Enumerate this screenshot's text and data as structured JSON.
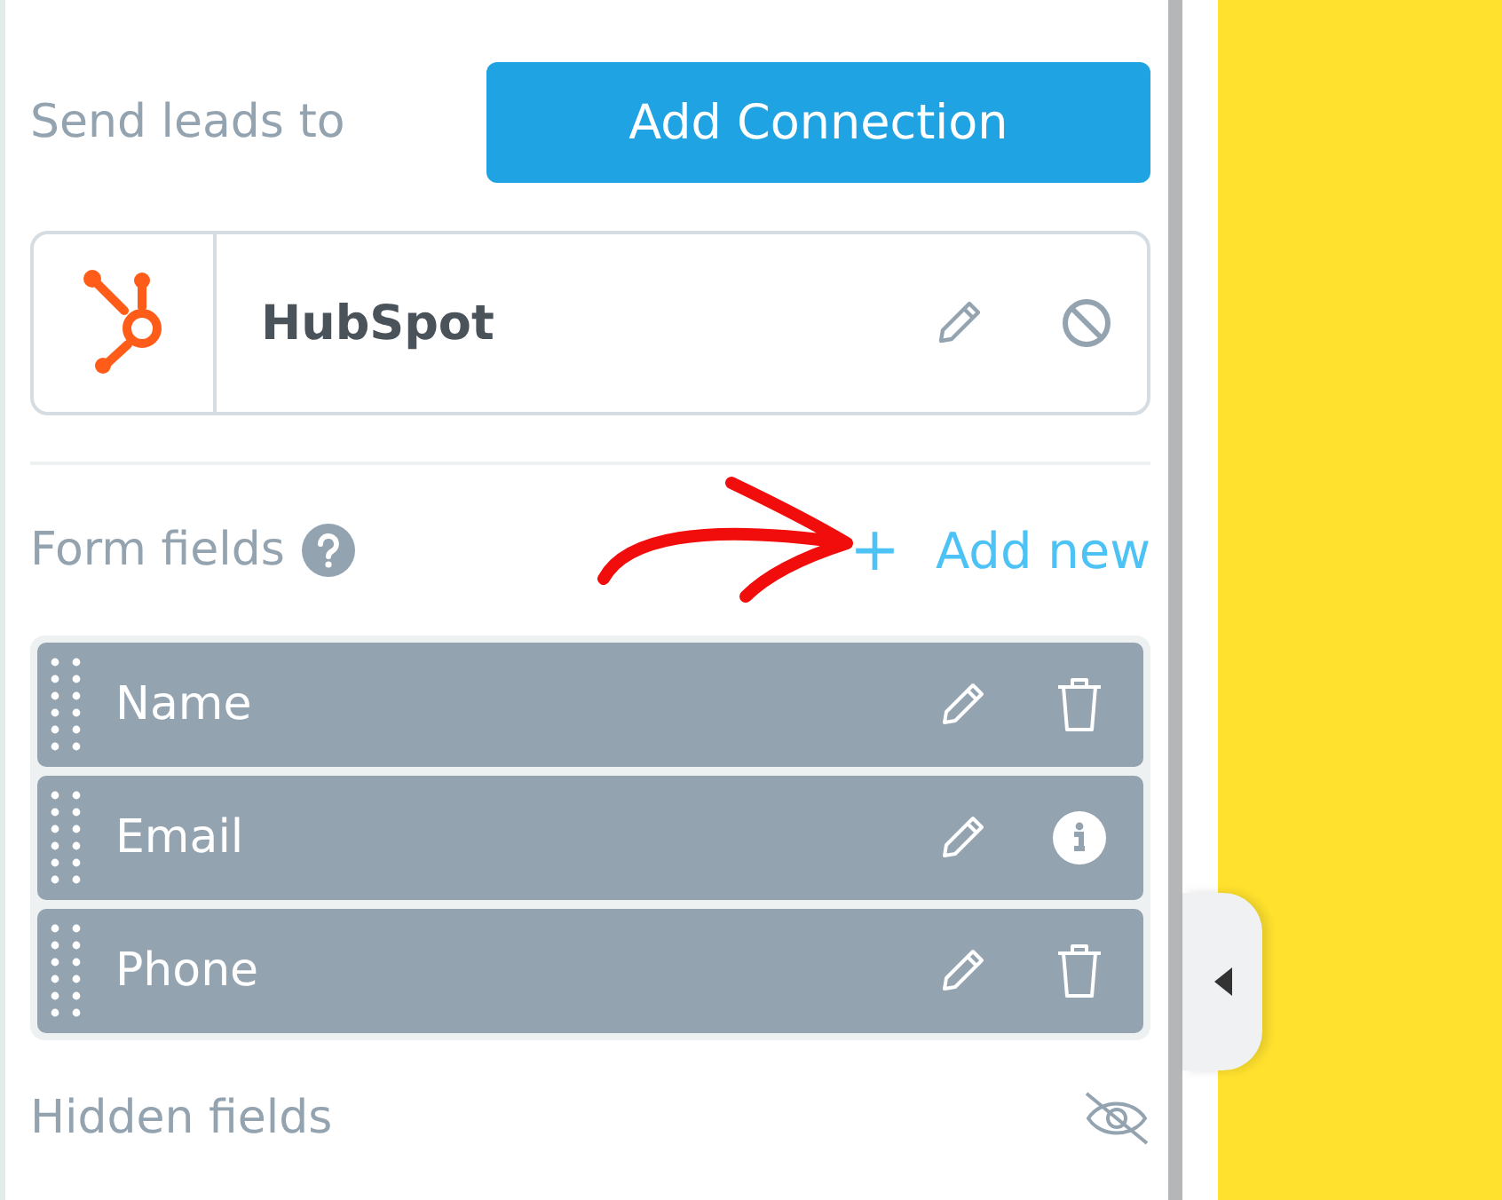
{
  "send_leads": {
    "label": "Send leads to",
    "button": "Add Connection"
  },
  "connection": {
    "name": "HubSpot"
  },
  "form_fields": {
    "label": "Form fields",
    "add_icon": "+",
    "add_label": "Add new",
    "fields": [
      {
        "name": "Name",
        "kind": "removable"
      },
      {
        "name": "Email",
        "kind": "required"
      },
      {
        "name": "Phone",
        "kind": "removable"
      }
    ]
  },
  "hidden_fields": {
    "label": "Hidden fields"
  }
}
